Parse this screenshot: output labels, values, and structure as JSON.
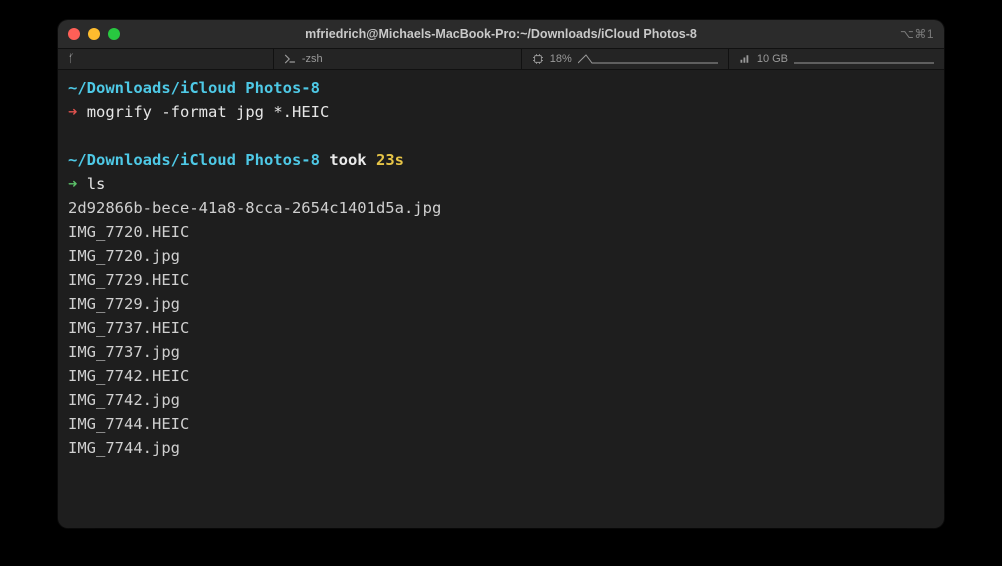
{
  "window": {
    "title": "mfriedrich@Michaels-MacBook-Pro:~/Downloads/iCloud Photos-8",
    "shortcut_hint": "⌥⌘1"
  },
  "status": {
    "branch_symbol": "ᚶ",
    "shell_label": "-zsh",
    "cpu_percent": "18%",
    "net_label": "10 GB"
  },
  "session": {
    "cwd": "~/Downloads/iCloud Photos-8",
    "prompt1_arrow": "➜",
    "cmd1": "mogrify -format jpg *.HEIC",
    "took_word": "took",
    "took_time": "23s",
    "prompt2_arrow": "➜",
    "cmd2": "ls",
    "ls_output": [
      "2d92866b-bece-41a8-8cca-2654c1401d5a.jpg",
      "IMG_7720.HEIC",
      "IMG_7720.jpg",
      "IMG_7729.HEIC",
      "IMG_7729.jpg",
      "IMG_7737.HEIC",
      "IMG_7737.jpg",
      "IMG_7742.HEIC",
      "IMG_7742.jpg",
      "IMG_7744.HEIC",
      "IMG_7744.jpg"
    ]
  }
}
